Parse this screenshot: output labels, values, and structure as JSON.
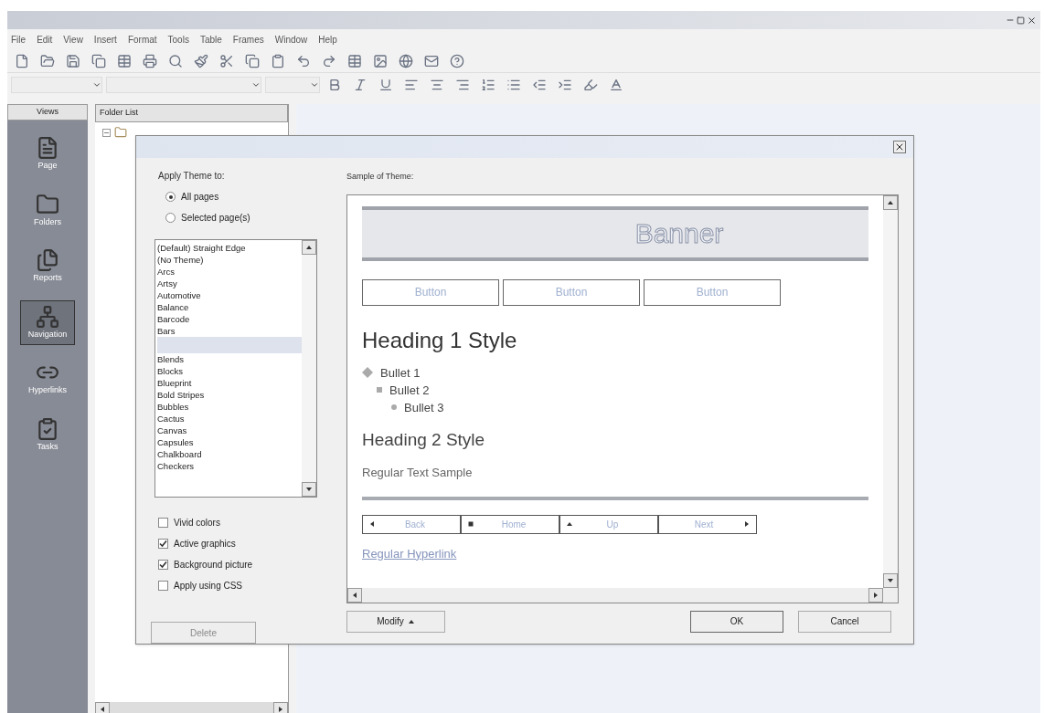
{
  "menu": [
    {
      "label": "File"
    },
    {
      "label": "Edit"
    },
    {
      "label": "View"
    },
    {
      "label": "Insert"
    },
    {
      "label": "Format"
    },
    {
      "label": "Tools"
    },
    {
      "label": "Table"
    },
    {
      "label": "Frames"
    },
    {
      "label": "Window"
    },
    {
      "label": "Help"
    }
  ],
  "views": {
    "title": "Views",
    "items": [
      {
        "kind": "page",
        "label": "Page",
        "selected": false
      },
      {
        "kind": "folders",
        "label": "Folders",
        "selected": false
      },
      {
        "kind": "reports",
        "label": "Reports",
        "selected": false
      },
      {
        "kind": "navigation",
        "label": "Navigation",
        "selected": true
      },
      {
        "kind": "hyperlinks",
        "label": "Hyperlinks",
        "selected": false
      },
      {
        "kind": "tasks",
        "label": "Tasks",
        "selected": false
      }
    ]
  },
  "folder_list": {
    "title": "Folder List"
  },
  "dialog": {
    "apply_label": "Apply Theme to:",
    "apply_options": [
      {
        "label": "All pages",
        "selected": true
      },
      {
        "label": "Selected page(s)",
        "selected": false
      }
    ],
    "themes": [
      {
        "label": "(Default) Straight Edge",
        "selected": false
      },
      {
        "label": "(No Theme)",
        "selected": false
      },
      {
        "label": "Arcs",
        "selected": false
      },
      {
        "label": "Artsy",
        "selected": false
      },
      {
        "label": "Automotive",
        "selected": false
      },
      {
        "label": "Balance",
        "selected": false
      },
      {
        "label": "Barcode",
        "selected": false
      },
      {
        "label": "Bars",
        "selected": false
      },
      {
        "kind": "blank",
        "selected": true
      },
      {
        "label": "Blends",
        "selected": false
      },
      {
        "label": "Blocks",
        "selected": false
      },
      {
        "label": "Blueprint",
        "selected": false
      },
      {
        "label": "Bold Stripes",
        "selected": false
      },
      {
        "label": "Bubbles",
        "selected": false
      },
      {
        "label": "Cactus",
        "selected": false
      },
      {
        "label": "Canvas",
        "selected": false
      },
      {
        "label": "Capsules",
        "selected": false
      },
      {
        "label": "Chalkboard",
        "selected": false
      },
      {
        "label": "Checkers",
        "selected": false
      }
    ],
    "options": [
      {
        "label": "Vivid colors",
        "checked": false
      },
      {
        "label": "Active graphics",
        "checked": true
      },
      {
        "label": "Background picture",
        "checked": true
      },
      {
        "label": "Apply using CSS",
        "checked": false
      }
    ],
    "delete_button": {
      "label": "Delete",
      "disabled": true
    },
    "sample_label": "Sample of Theme:",
    "sample": {
      "banner": "Banner",
      "buttons": [
        "Button",
        "Button",
        "Button"
      ],
      "heading1": "Heading 1 Style",
      "bullets": [
        {
          "label": "Bullet 1",
          "kind": "diamond"
        },
        {
          "label": "Bullet 2",
          "kind": "square"
        },
        {
          "label": "Bullet 3",
          "kind": "dot"
        }
      ],
      "heading2": "Heading 2 Style",
      "regular_text": "Regular Text Sample",
      "nav": [
        {
          "label": "Back",
          "kind": "left"
        },
        {
          "label": "Home",
          "kind": "home"
        },
        {
          "label": "Up",
          "kind": "up"
        },
        {
          "label": "Next",
          "kind": "right"
        }
      ],
      "hyperlink": "Regular Hyperlink"
    },
    "modify_button": "Modify",
    "ok_button": "OK",
    "cancel_button": "Cancel"
  }
}
